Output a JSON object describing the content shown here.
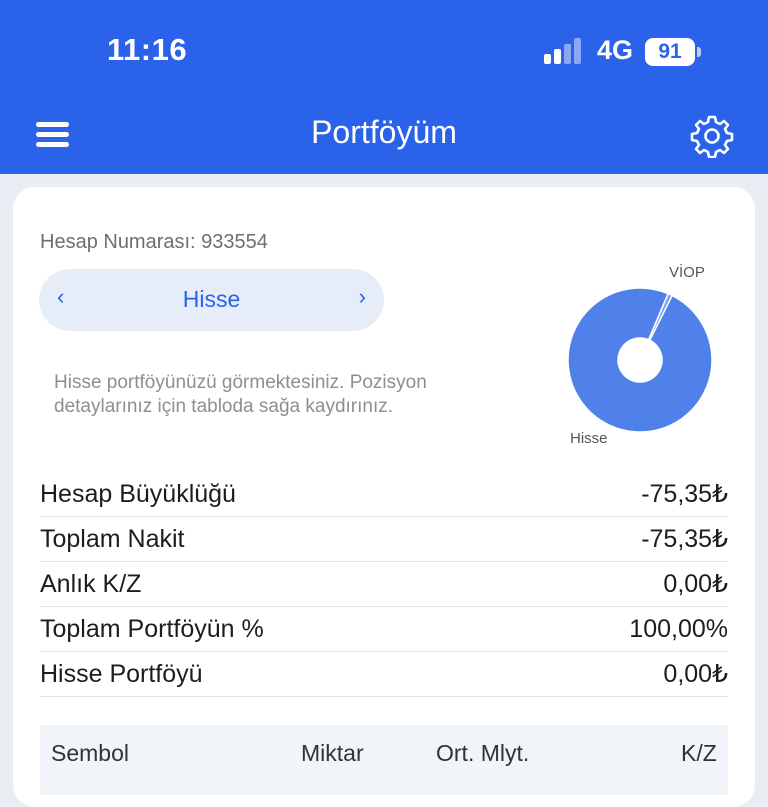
{
  "status_bar": {
    "time": "11:16",
    "network": "4G",
    "battery": "91"
  },
  "header": {
    "title": "Portföyüm"
  },
  "account": {
    "label": "Hesap Numarası: 933554"
  },
  "selector": {
    "prev": "‹",
    "label": "Hisse",
    "next": "›"
  },
  "description": "Hisse portföyünüzü görmektesiniz. Pozisyon detaylarınız için tabloda sağa kaydırınız.",
  "chart_data": {
    "type": "pie",
    "categories": [
      "Hisse",
      "VİOP"
    ],
    "values": [
      99,
      1
    ],
    "colors": [
      "#5080ea",
      "#7aa0f0"
    ]
  },
  "summary": [
    {
      "label": "Hesap Büyüklüğü",
      "value": "-75,35₺"
    },
    {
      "label": "Toplam Nakit",
      "value": "-75,35₺"
    },
    {
      "label": "Anlık K/Z",
      "value": "0,00₺"
    },
    {
      "label": "Toplam Portföyün %",
      "value": "100,00%"
    },
    {
      "label": "Hisse Portföyü",
      "value": "0,00₺"
    }
  ],
  "table": {
    "columns": [
      "Sembol",
      "Miktar",
      "Ort. Mlyt.",
      "K/Z"
    ]
  }
}
